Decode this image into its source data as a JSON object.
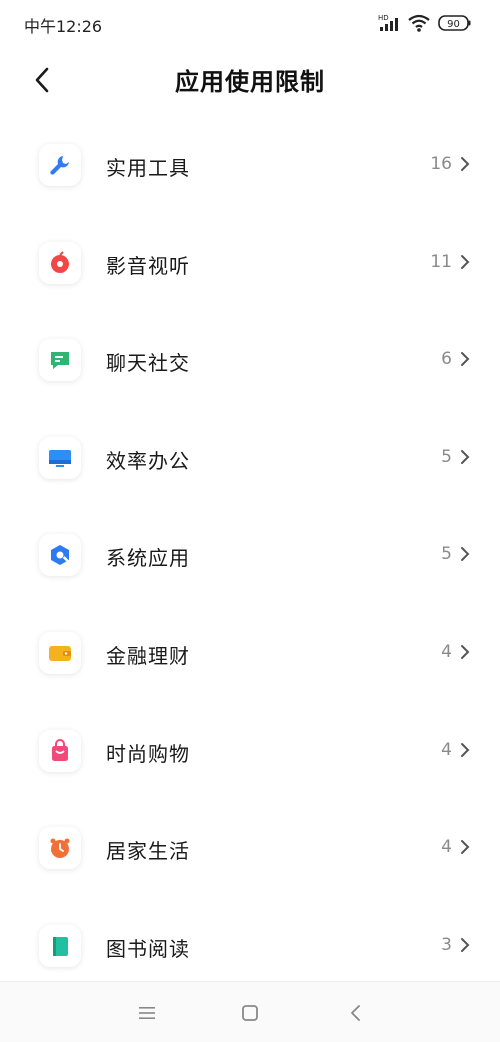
{
  "status_bar": {
    "time": "中午12:26",
    "network_label": "HD",
    "battery": "90"
  },
  "header": {
    "title": "应用使用限制"
  },
  "categories": [
    {
      "label": "实用工具",
      "count": "16",
      "icon": "wrench-icon",
      "color": "#2f7cf6"
    },
    {
      "label": "影音视听",
      "count": "11",
      "icon": "media-icon",
      "color": "#f04848"
    },
    {
      "label": "聊天社交",
      "count": "6",
      "icon": "chat-icon",
      "color": "#2fb573"
    },
    {
      "label": "效率办公",
      "count": "5",
      "icon": "monitor-icon",
      "color": "#2b8ff5"
    },
    {
      "label": "系统应用",
      "count": "5",
      "icon": "system-icon",
      "color": "#2c7bf2"
    },
    {
      "label": "金融理财",
      "count": "4",
      "icon": "wallet-icon",
      "color": "#f5b21f"
    },
    {
      "label": "时尚购物",
      "count": "4",
      "icon": "shopping-bag-icon",
      "color": "#f0497a"
    },
    {
      "label": "居家生活",
      "count": "4",
      "icon": "alarm-clock-icon",
      "color": "#f07038"
    },
    {
      "label": "图书阅读",
      "count": "3",
      "icon": "book-icon",
      "color": "#22bfa1"
    }
  ],
  "nav_bar": {
    "icons": [
      "menu-icon",
      "home-square-icon",
      "back-triangle-icon"
    ]
  }
}
